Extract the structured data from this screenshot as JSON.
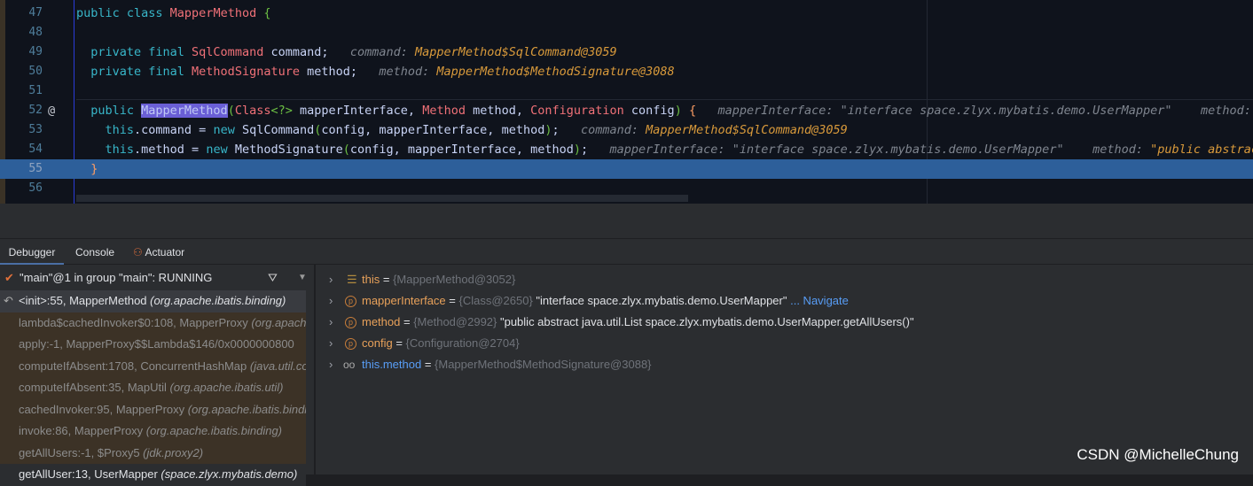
{
  "editor": {
    "lines": [
      {
        "n": "47",
        "t": [
          [
            "public class ",
            "kw"
          ],
          [
            "MapperMethod ",
            "ty"
          ],
          [
            "{",
            "br"
          ]
        ]
      },
      {
        "n": "48",
        "t": []
      },
      {
        "n": "49",
        "t": [
          [
            "  private final ",
            "kw"
          ],
          [
            "SqlCommand ",
            "ty"
          ],
          [
            "command;",
            ""
          ],
          [
            "   command: ",
            "hint"
          ],
          [
            "MapperMethod$SqlCommand@3059",
            "hv"
          ]
        ]
      },
      {
        "n": "50",
        "t": [
          [
            "  private final ",
            "kw"
          ],
          [
            "MethodSignature ",
            "ty"
          ],
          [
            "method;",
            ""
          ],
          [
            "   method: ",
            "hint"
          ],
          [
            "MapperMethod$MethodSignature@3088",
            "hv"
          ]
        ]
      },
      {
        "n": "51",
        "t": []
      },
      {
        "n": "52",
        "at": "@",
        "t": [
          [
            "  public ",
            "kw"
          ],
          [
            "MapperMethod",
            "hl"
          ],
          [
            "(",
            "br"
          ],
          [
            "Class",
            "ty"
          ],
          [
            "<?>",
            "br"
          ],
          [
            " mapperInterface, ",
            ""
          ],
          [
            "Method ",
            "ty"
          ],
          [
            "method, ",
            ""
          ],
          [
            "Configuration ",
            "ty"
          ],
          [
            "config",
            ""
          ],
          [
            ")",
            "br"
          ],
          [
            " {",
            "br2"
          ],
          [
            "   mapperInterface: \"interface space.zlyx.mybatis.demo.UserMapper\"    method: \"p",
            "hint"
          ]
        ]
      },
      {
        "n": "53",
        "t": [
          [
            "    this",
            "kw"
          ],
          [
            ".command = ",
            ""
          ],
          [
            "new ",
            "kw"
          ],
          [
            "SqlCommand",
            ""
          ],
          [
            "(",
            "br"
          ],
          [
            "config, mapperInterface, method",
            ""
          ],
          [
            ")",
            "br"
          ],
          [
            ";",
            ""
          ],
          [
            "   command: ",
            "hint"
          ],
          [
            "MapperMethod$SqlCommand@3059",
            "hv"
          ]
        ]
      },
      {
        "n": "54",
        "t": [
          [
            "    this",
            "kw"
          ],
          [
            ".method = ",
            ""
          ],
          [
            "new ",
            "kw"
          ],
          [
            "MethodSignature",
            ""
          ],
          [
            "(",
            "br"
          ],
          [
            "config, mapperInterface, method",
            ""
          ],
          [
            ")",
            "br"
          ],
          [
            ";",
            ""
          ],
          [
            "   mapperInterface: \"interface space.zlyx.mybatis.demo.UserMapper\"    method: ",
            "hint"
          ],
          [
            "\"public abstract ",
            "hv"
          ]
        ]
      },
      {
        "n": "55",
        "cur": true,
        "t": [
          [
            "  }",
            "br2"
          ]
        ]
      },
      {
        "n": "56",
        "t": []
      }
    ]
  },
  "tabs": [
    {
      "label": "Debugger"
    },
    {
      "label": "Console"
    },
    {
      "label": "Actuator"
    }
  ],
  "thread": {
    "label": "\"main\"@1 in group \"main\": RUNNING"
  },
  "frames": [
    {
      "m": "<init>:55, MapperMethod ",
      "p": "(org.apache.ibatis.binding)"
    },
    {
      "m": "lambda$cachedInvoker$0:108, MapperProxy ",
      "p": "(org.apache.ibatis.binding)"
    },
    {
      "m": "apply:-1, MapperProxy$$Lambda$146/0x0000000800",
      "p": ""
    },
    {
      "m": "computeIfAbsent:1708, ConcurrentHashMap ",
      "p": "(java.util.concurrent)"
    },
    {
      "m": "computeIfAbsent:35, MapUtil ",
      "p": "(org.apache.ibatis.util)"
    },
    {
      "m": "cachedInvoker:95, MapperProxy ",
      "p": "(org.apache.ibatis.binding)"
    },
    {
      "m": "invoke:86, MapperProxy ",
      "p": "(org.apache.ibatis.binding)"
    },
    {
      "m": "getAllUsers:-1, $Proxy5 ",
      "p": "(jdk.proxy2)"
    },
    {
      "m": "getAllUser:13, UserMapper ",
      "p": "(space.zlyx.mybatis.demo)"
    }
  ],
  "variables": [
    {
      "icon": "field-list-icon",
      "name": "this",
      "ref": "{MapperMethod@3052}",
      "val": ""
    },
    {
      "icon": "parameter-icon",
      "name": "mapperInterface",
      "ref": "{Class@2650}",
      "val": " \"interface space.zlyx.mybatis.demo.UserMapper\"",
      "link": " ... Navigate"
    },
    {
      "icon": "parameter-icon",
      "name": "method",
      "ref": "{Method@2992}",
      "val": " \"public abstract java.util.List space.zlyx.mybatis.demo.UserMapper.getAllUsers()\""
    },
    {
      "icon": "parameter-icon",
      "name": "config",
      "ref": "{Configuration@2704}",
      "val": ""
    },
    {
      "icon": "watch-icon",
      "name": "this.method",
      "ref": "{MapperMethod$MethodSignature@3088}",
      "val": ""
    }
  ],
  "watermark": "CSDN @MichelleChung"
}
